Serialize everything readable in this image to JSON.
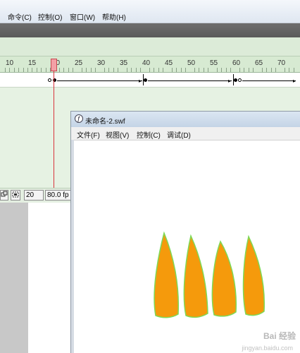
{
  "menubar": {
    "items": [
      "命令(C)",
      "控制(O)",
      "窗口(W)",
      "帮助(H)"
    ]
  },
  "timeline": {
    "ruler_labels": [
      "10",
      "15",
      "20",
      "25",
      "30",
      "35",
      "40",
      "45",
      "50",
      "55",
      "60",
      "65",
      "70"
    ],
    "current_frame": "20",
    "frame_rate": "80.0 fp"
  },
  "swf_window": {
    "title": "未命名-2.swf",
    "menu": [
      "文件(F)",
      "视图(V)",
      "控制(C)",
      "调试(D)"
    ],
    "petal_colors": {
      "fill": "#f59a0c",
      "stroke": "#7ed957"
    }
  },
  "watermark": {
    "text": "Bai 经验",
    "sub": "jingyan.baidu.com"
  }
}
